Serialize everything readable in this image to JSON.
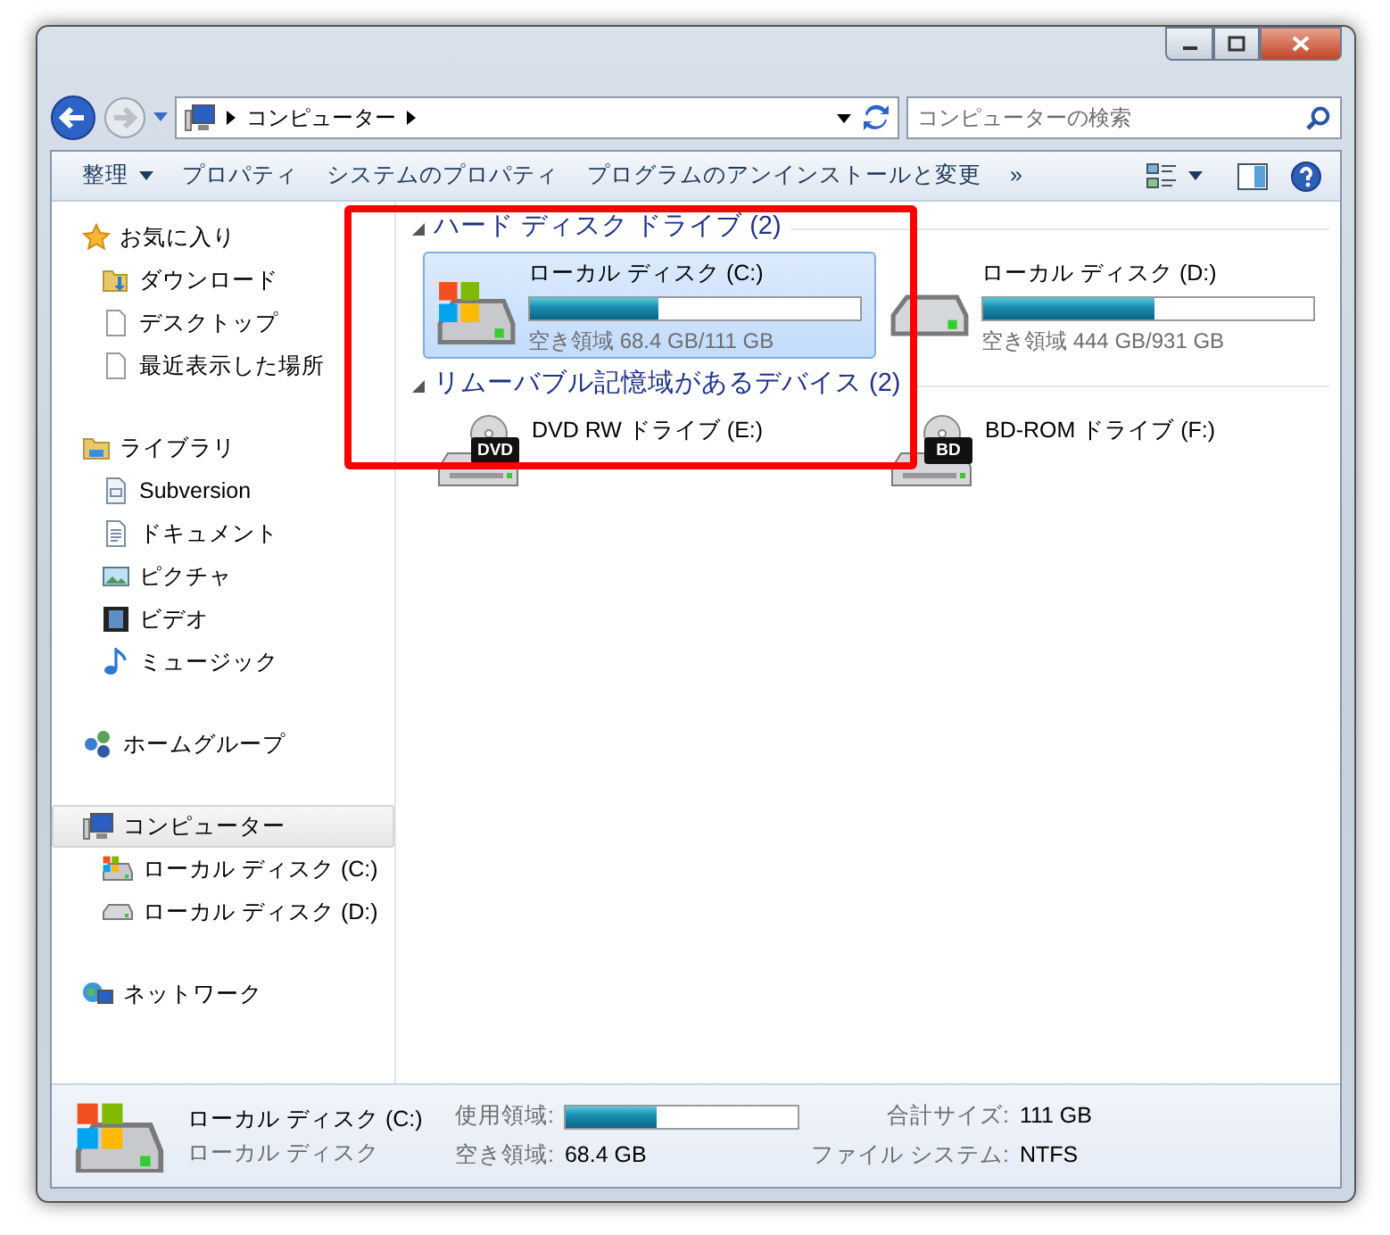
{
  "window": {
    "controls": [
      {
        "kind": "minimize"
      },
      {
        "kind": "maximize"
      },
      {
        "kind": "close"
      }
    ]
  },
  "nav": {
    "breadcrumb": [
      "コンピューター"
    ],
    "search": {
      "placeholder": "コンピューターの検索"
    }
  },
  "toolbar": [
    {
      "label": "整理",
      "dropdown": true
    },
    {
      "label": "プロパティ",
      "dropdown": false
    },
    {
      "label": "システムのプロパティ",
      "dropdown": false
    },
    {
      "label": "プログラムのアンインストールと変更",
      "dropdown": false
    },
    {
      "label": "»",
      "dropdown": false
    }
  ],
  "sidebar": [
    {
      "label": "お気に入り",
      "kind": "favorites",
      "selected": false,
      "children": [
        {
          "label": "ダウンロード",
          "kind": "download",
          "selected": false
        },
        {
          "label": "デスクトップ",
          "kind": "page",
          "selected": false
        },
        {
          "label": "最近表示した場所",
          "kind": "page",
          "selected": false
        }
      ]
    },
    {
      "label": "ライブラリ",
      "kind": "library",
      "selected": false,
      "children": [
        {
          "label": "Subversion",
          "kind": "subversion",
          "selected": false
        },
        {
          "label": "ドキュメント",
          "kind": "documents",
          "selected": false
        },
        {
          "label": "ピクチャ",
          "kind": "pictures",
          "selected": false
        },
        {
          "label": "ビデオ",
          "kind": "videos",
          "selected": false
        },
        {
          "label": "ミュージック",
          "kind": "music",
          "selected": false
        }
      ]
    },
    {
      "label": "ホームグループ",
      "kind": "homegroup",
      "selected": false
    },
    {
      "label": "コンピューター",
      "kind": "computer",
      "selected": true,
      "children": [
        {
          "label": "ローカル ディスク (C:)",
          "kind": "system-disk",
          "selected": false
        },
        {
          "label": "ローカル ディスク (D:)",
          "kind": "disk",
          "selected": false
        }
      ]
    },
    {
      "label": "ネットワーク",
      "kind": "network",
      "selected": false
    }
  ],
  "groups": [
    {
      "title": "ハード ディスク ドライブ (2)",
      "expanded": true,
      "items": [
        {
          "name": "ローカル ディスク (C:)",
          "kind": "system-disk",
          "level": 0.39,
          "free": "空き領域 68.4 GB/111 GB",
          "selected": true
        },
        {
          "name": "ローカル ディスク (D:)",
          "kind": "disk",
          "level": 0.52,
          "free": "空き領域 444 GB/931 GB",
          "selected": false
        }
      ]
    },
    {
      "title": "リムーバブル記憶域があるデバイス (2)",
      "expanded": true,
      "items": [
        {
          "name": "DVD RW ドライブ (E:)",
          "kind": "dvd",
          "badge": "DVD",
          "selected": false
        },
        {
          "name": "BD-ROM ドライブ (F:)",
          "kind": "dvd",
          "badge": "BD",
          "selected": false
        }
      ]
    }
  ],
  "details": {
    "name": "ローカル ディスク (C:)",
    "type": "ローカル ディスク",
    "used_label": "使用領域:",
    "level": 0.39,
    "free_label": "空き領域:",
    "free_value": "68.4 GB",
    "total_label": "合計サイズ:",
    "total_value": "111 GB",
    "fs_label": "ファイル システム:",
    "fs_value": "NTFS"
  },
  "annotation": {
    "kind": "highlight-box",
    "color": "#ff0000"
  }
}
